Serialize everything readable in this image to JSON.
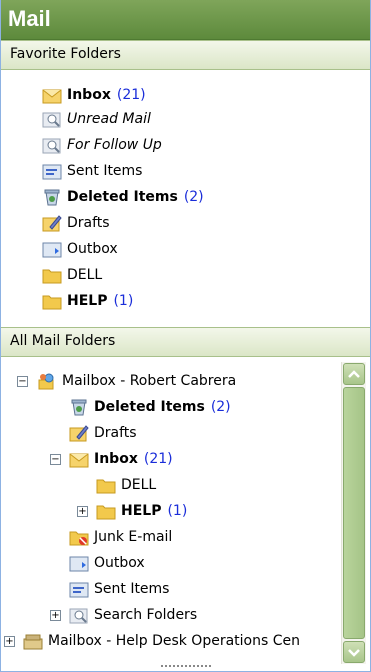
{
  "pane_title": "Mail",
  "favorites": {
    "header": "Favorite Folders",
    "items": [
      {
        "label": "Inbox",
        "count": "(21)",
        "style": "bold",
        "icon": "inbox-icon"
      },
      {
        "label": "Unread Mail",
        "count": "",
        "style": "italic",
        "icon": "search-folder-icon"
      },
      {
        "label": "For Follow Up",
        "count": "",
        "style": "italic",
        "icon": "search-folder-icon"
      },
      {
        "label": "Sent Items",
        "count": "",
        "style": "normal",
        "icon": "sent-items-icon"
      },
      {
        "label": "Deleted Items",
        "count": "(2)",
        "style": "bold",
        "icon": "deleted-items-icon"
      },
      {
        "label": "Drafts",
        "count": "",
        "style": "normal",
        "icon": "drafts-icon"
      },
      {
        "label": "Outbox",
        "count": "",
        "style": "normal",
        "icon": "outbox-icon"
      },
      {
        "label": "DELL",
        "count": "",
        "style": "normal",
        "icon": "folder-icon"
      },
      {
        "label": "HELP",
        "count": "(1)",
        "style": "bold",
        "icon": "folder-icon"
      }
    ]
  },
  "all_folders": {
    "header": "All Mail Folders",
    "items": [
      {
        "label": "Mailbox - Robert Cabrera",
        "count": "",
        "style": "normal",
        "icon": "mailbox-icon",
        "expander": "−"
      },
      {
        "label": "Deleted Items",
        "count": "(2)",
        "style": "bold",
        "icon": "deleted-items-icon",
        "expander": ""
      },
      {
        "label": "Drafts",
        "count": "",
        "style": "normal",
        "icon": "drafts-icon",
        "expander": ""
      },
      {
        "label": "Inbox",
        "count": "(21)",
        "style": "bold",
        "icon": "inbox-icon",
        "expander": "−"
      },
      {
        "label": "DELL",
        "count": "",
        "style": "normal",
        "icon": "folder-icon",
        "expander": ""
      },
      {
        "label": "HELP",
        "count": "(1)",
        "style": "bold",
        "icon": "folder-icon",
        "expander": "+"
      },
      {
        "label": "Junk E-mail",
        "count": "",
        "style": "normal",
        "icon": "junk-mail-icon",
        "expander": ""
      },
      {
        "label": "Outbox",
        "count": "",
        "style": "normal",
        "icon": "outbox-icon",
        "expander": ""
      },
      {
        "label": "Sent Items",
        "count": "",
        "style": "normal",
        "icon": "sent-items-icon",
        "expander": ""
      },
      {
        "label": "Search Folders",
        "count": "",
        "style": "normal",
        "icon": "search-folder-icon",
        "expander": "+"
      },
      {
        "label": "Mailbox - Help Desk Operations Cen",
        "count": "",
        "style": "normal",
        "icon": "mailbox-icon",
        "expander": "+"
      }
    ]
  },
  "colors": {
    "title_bar": "#6f9a4b",
    "count_text": "#1a2dd9",
    "folder_yellow": "#f2c94c"
  }
}
